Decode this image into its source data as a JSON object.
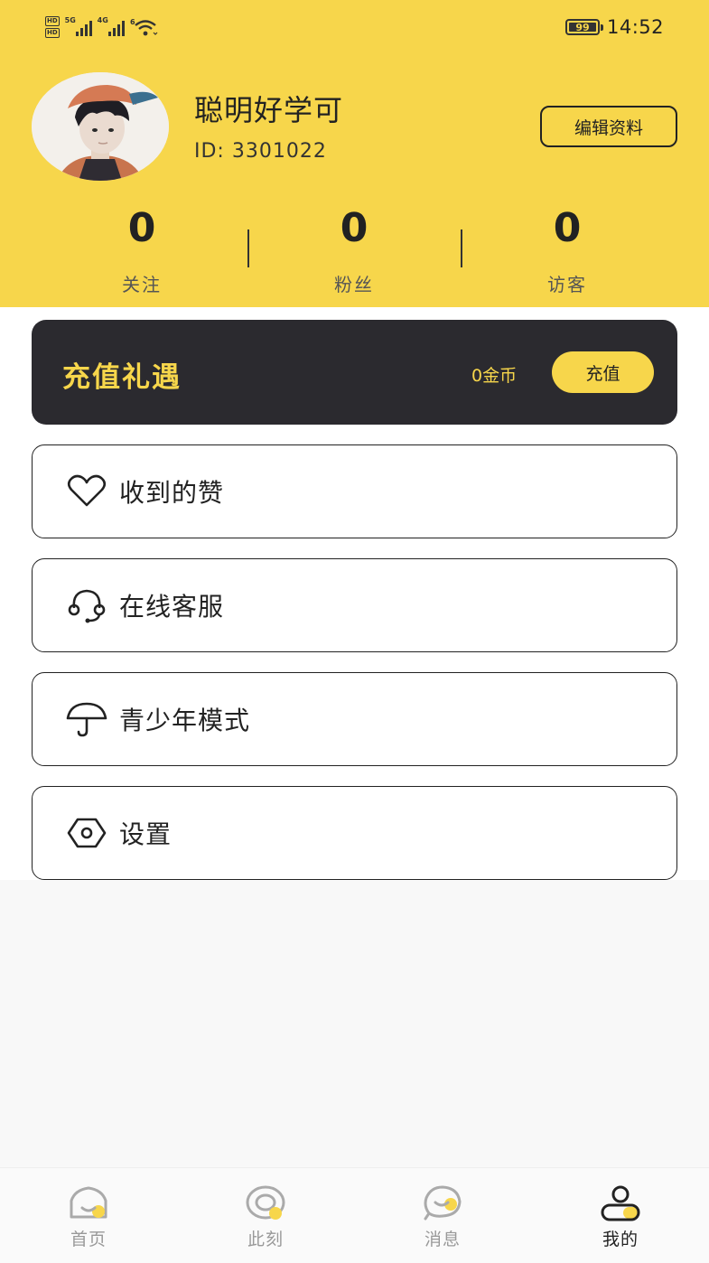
{
  "status_bar": {
    "signal1_label": "5G",
    "signal2_label": "4G",
    "wifi_label": "6",
    "battery": "99",
    "battery_level": 0.99,
    "time": "14:52"
  },
  "profile": {
    "nickname": "聪明好学可",
    "user_id": "ID: 3301022",
    "edit_label": "编辑资料"
  },
  "stats": [
    {
      "value": "0",
      "label": "关注"
    },
    {
      "value": "0",
      "label": "粉丝"
    },
    {
      "value": "0",
      "label": "访客"
    }
  ],
  "recharge": {
    "title": "充值礼遇",
    "coins": "0金币",
    "button_label": "充值"
  },
  "menu": [
    {
      "label": "收到的赞",
      "icon": "heart-icon"
    },
    {
      "label": "在线客服",
      "icon": "headset-icon"
    },
    {
      "label": "青少年模式",
      "icon": "umbrella-icon"
    },
    {
      "label": "设置",
      "icon": "settings-hexagon-icon"
    }
  ],
  "nav": [
    {
      "label": "首页",
      "icon": "home-icon",
      "active": false
    },
    {
      "label": "此刻",
      "icon": "moment-icon",
      "active": false
    },
    {
      "label": "消息",
      "icon": "message-icon",
      "active": false
    },
    {
      "label": "我的",
      "icon": "profile-icon",
      "active": true
    }
  ],
  "colors": {
    "accent": "#f7d64b",
    "dark_card": "#2b2a2f",
    "text": "#222222"
  }
}
